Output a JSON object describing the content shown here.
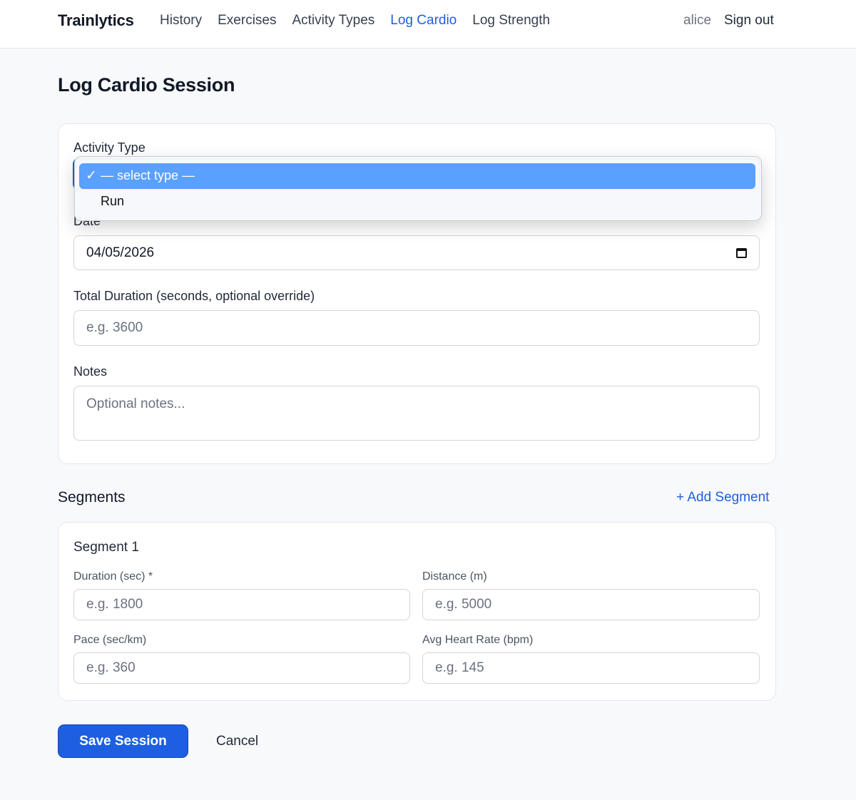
{
  "nav": {
    "brand": "Trainlytics",
    "links": [
      "History",
      "Exercises",
      "Activity Types",
      "Log Cardio",
      "Log Strength"
    ],
    "active": "Log Cardio",
    "user": "alice",
    "signout": "Sign out"
  },
  "page": {
    "title": "Log Cardio Session"
  },
  "form": {
    "activity_type": {
      "label": "Activity Type",
      "options": [
        "— select type —",
        "Run"
      ],
      "selected": "— select type —"
    },
    "date": {
      "label": "Date",
      "value": "04/05/2026"
    },
    "duration": {
      "label": "Total Duration (seconds, optional override)",
      "placeholder": "e.g. 3600"
    },
    "notes": {
      "label": "Notes",
      "placeholder": "Optional notes..."
    }
  },
  "segments": {
    "title": "Segments",
    "add_label": "+ Add Segment",
    "items": [
      {
        "title": "Segment 1",
        "duration": {
          "label": "Duration (sec) *",
          "placeholder": "e.g. 1800"
        },
        "distance": {
          "label": "Distance (m)",
          "placeholder": "e.g. 5000"
        },
        "pace": {
          "label": "Pace (sec/km)",
          "placeholder": "e.g. 360"
        },
        "heart_rate": {
          "label": "Avg Heart Rate (bpm)",
          "placeholder": "e.g. 145"
        }
      }
    ]
  },
  "actions": {
    "save": "Save Session",
    "cancel": "Cancel"
  },
  "colors": {
    "accent": "#1d5fe0",
    "selected_option": "#5aa0fd",
    "page_bg": "#f8f9fb"
  }
}
